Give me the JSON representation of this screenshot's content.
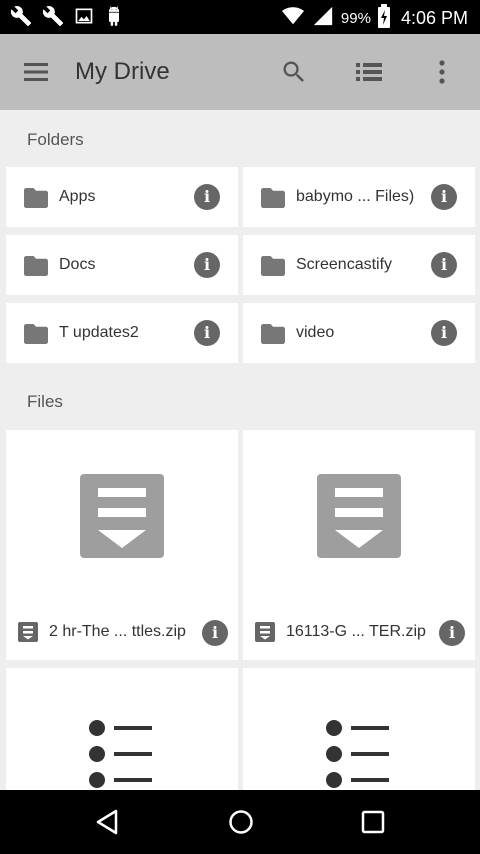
{
  "status_bar": {
    "battery": "99%",
    "time": "4:06 PM",
    "icons": [
      "wrench-icon",
      "wrench-icon",
      "image-icon",
      "android-icon",
      "wifi-icon",
      "signal-icon",
      "battery-charging-icon"
    ]
  },
  "app_bar": {
    "title": "My Drive",
    "icons": [
      "menu-icon",
      "search-icon",
      "list-view-icon",
      "more-vert-icon"
    ]
  },
  "sections": {
    "folders_label": "Folders",
    "files_label": "Files"
  },
  "folders": [
    {
      "name": "Apps"
    },
    {
      "name": "babymo ... Files)"
    },
    {
      "name": "Docs"
    },
    {
      "name": "Screencastify"
    },
    {
      "name": "T updates2"
    },
    {
      "name": "video"
    }
  ],
  "files": [
    {
      "name": "2 hr-The ... ttles.zip",
      "type_icon": "zip-file-icon"
    },
    {
      "name": "16113-G ... TER.zip",
      "type_icon": "zip-file-icon"
    }
  ],
  "info_glyph": "i",
  "colors": {
    "app_bar": "#bdbdbd",
    "background": "#eeeeee",
    "icon_gray": "#666666"
  }
}
